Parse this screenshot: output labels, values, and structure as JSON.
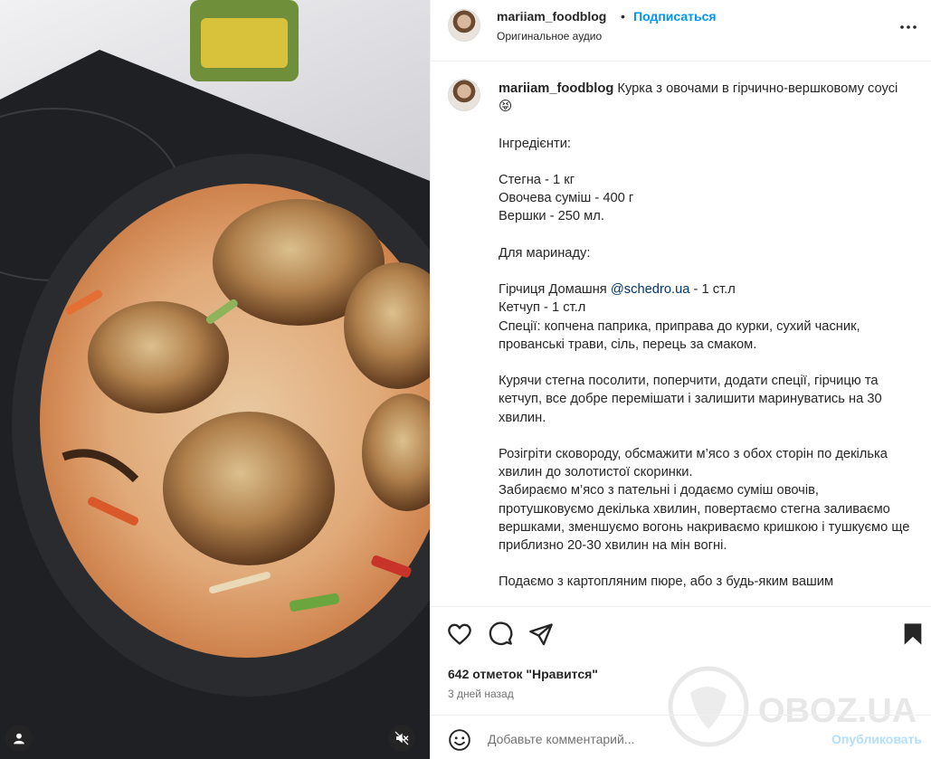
{
  "post": {
    "username": "mariiam_foodblog",
    "separator": "•",
    "follow_label": "Подписаться",
    "audio_label": "Оригинальное аудио",
    "caption_title": "Курка з овочами в гірчично-вершковому соусі 😝",
    "caption_body_1": "Інгредієнти:\n\nСтегна - 1 кг\nОвочева суміш - 400 г\nВершки - 250 мл.\n\nДля маринаду:\n\nГірчиця Домашня ",
    "mention": "@schedro.ua",
    "caption_body_2": " - 1 ст.л\nКетчуп - 1 ст.л\nСпеції: копчена паприка, приправа до курки, сухий часник, прованські трави, сіль, перець за смаком.\n\nКурячи стегна посолити, поперчити, додати спеції, гірчицю та кетчуп, все добре перемішати і залишити маринуватись на 30 хвилин.\n\nРозігріти сковороду, обсмажити м’ясо з обох сторін по декілька хвилин до золотистої скоринки.\nЗабираємо м’ясо з пательні і додаємо суміш овочів, протушковуємо декілька хвилин, повертаємо стегна заливаємо вершками, зменшуємо вогонь накриваємо кришкою і тушкуємо ще приблизно 20-30 хвилин на мін вогні.\n\nПодаємо з картопляним пюре, або з будь-яким вашим",
    "likes_label": "642 отметок \"Нравится\"",
    "time_ago": "3 дней назад"
  },
  "comment": {
    "placeholder": "Добавьте комментарий...",
    "publish_label": "Опубликовать"
  },
  "watermark": {
    "text": "OBOZ.UA"
  },
  "icons": {
    "more": "more-horizontal-icon",
    "like": "heart-icon",
    "comment": "comment-icon",
    "share": "send-icon",
    "save": "bookmark-icon",
    "emoji": "emoji-icon",
    "user_tag": "user-icon",
    "mute": "speaker-muted-icon"
  },
  "colors": {
    "link": "#0095f6",
    "publish_disabled": "#b2dffc",
    "text": "#262626",
    "secondary": "#737373"
  }
}
